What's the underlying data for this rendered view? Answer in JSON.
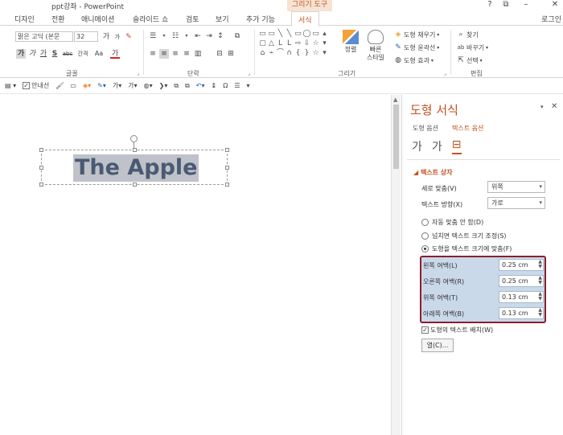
{
  "window": {
    "title": "ppt강좌 - PowerPoint",
    "context_tool": "그리기 도구",
    "controls": [
      "?",
      "⧉",
      "–",
      "✕"
    ],
    "user": "로그인"
  },
  "tabs": [
    "디자인",
    "전환",
    "애니메이션",
    "슬라이드 쇼",
    "검토",
    "보기",
    "추가 기능",
    "서식"
  ],
  "active_tab": "서식",
  "ribbon": {
    "font_name": "맑은 고딕 (본문",
    "font_size": "32",
    "font_grow": "가",
    "font_shrink": "가",
    "bold": "가",
    "italic": "가",
    "underline": "가",
    "strike": "S",
    "abc": "abc",
    "char_spacing": "간격",
    "change_case": "Aa",
    "font_color": "가",
    "groups": {
      "font": "글꼴",
      "paragraph": "단락",
      "drawing": "그리기",
      "editing": "편집"
    },
    "arrange": "정렬",
    "quick_styles": "빠른\n스타일",
    "shape_fill": "도형 채우기",
    "shape_outline": "도형 윤곽선",
    "shape_effects": "도형 효과",
    "find": "찾기",
    "replace": "바꾸기",
    "select": "선택"
  },
  "qat": {
    "guides_label": "안내선",
    "guides_checked": true
  },
  "slide": {
    "text": "The Apple"
  },
  "pane": {
    "title": "도형 서식",
    "tab_shape": "도형 옵션",
    "tab_text": "텍스트 옵션",
    "section": "텍스트 상자",
    "valign_label": "세로 맞춤(V)",
    "valign_value": "위쪽",
    "direction_label": "텍스트 방향(X)",
    "direction_value": "가로",
    "autofit": [
      {
        "label": "자동 맞춤 안 함(D)",
        "selected": false
      },
      {
        "label": "넘치면 텍스트 크기 조정(S)",
        "selected": false
      },
      {
        "label": "도형을 텍스트 크기에 맞춤(F)",
        "selected": true
      }
    ],
    "margins": [
      {
        "label": "왼쪽 여백(L)",
        "value": "0.25 cm"
      },
      {
        "label": "오른쪽 여백(R)",
        "value": "0.25 cm"
      },
      {
        "label": "위쪽 여백(T)",
        "value": "0.13 cm"
      },
      {
        "label": "아래쪽 여백(B)",
        "value": "0.13 cm"
      }
    ],
    "wrap_label": "도형의 텍스트 배치(W)",
    "wrap_checked": true,
    "columns_button": "열(C)..."
  }
}
